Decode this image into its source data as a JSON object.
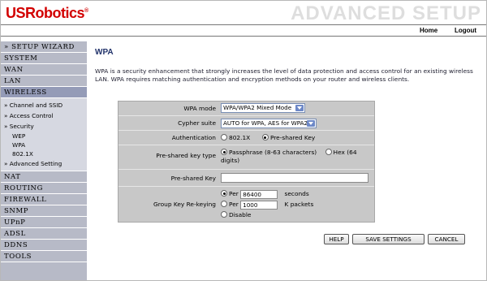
{
  "brand": {
    "logo": "USRobotics",
    "trademark": "®",
    "section_title": "ADVANCED SETUP"
  },
  "topnav": {
    "home": "Home",
    "logout": "Logout"
  },
  "sidebar": {
    "main_top": [
      {
        "label": "» SETUP WIZARD"
      },
      {
        "label": "SYSTEM"
      },
      {
        "label": "WAN"
      },
      {
        "label": "LAN"
      },
      {
        "label": "WIRELESS"
      }
    ],
    "wireless_sub": [
      {
        "label": "» Channel and SSID"
      },
      {
        "label": "» Access Control"
      },
      {
        "label": "» Security"
      }
    ],
    "security_sub": [
      {
        "label": "WEP"
      },
      {
        "label": "WPA"
      },
      {
        "label": "802.1X"
      }
    ],
    "advanced_setting": "» Advanced Setting",
    "main_bottom": [
      {
        "label": "NAT"
      },
      {
        "label": "ROUTING"
      },
      {
        "label": "FIREWALL"
      },
      {
        "label": "SNMP"
      },
      {
        "label": "UPnP"
      },
      {
        "label": "ADSL"
      },
      {
        "label": "DDNS"
      },
      {
        "label": "TOOLS"
      }
    ]
  },
  "page": {
    "title": "WPA",
    "description": "WPA is a security enhancement that strongly increases the level of data protection and access control for an existing wireless LAN. WPA requires matching authentication and encryption methods on your router and wireless clients."
  },
  "form": {
    "wpa_mode": {
      "label": "WPA mode",
      "value": "WPA/WPA2 Mixed Mode"
    },
    "cypher_suite": {
      "label": "Cypher suite",
      "value": "AUTO for WPA, AES for WPA2"
    },
    "authentication": {
      "label": "Authentication",
      "option1": "802.1X",
      "option2": "Pre-shared Key",
      "selected": "Pre-shared Key"
    },
    "psk_type": {
      "label": "Pre-shared key type",
      "option1": "Passphrase (8-63 characters)",
      "option2": "Hex (64 digits)",
      "selected": "Passphrase (8-63 characters)"
    },
    "psk": {
      "label": "Pre-shared Key",
      "value": ""
    },
    "rekey": {
      "label": "Group Key Re-keying",
      "per_label": "Per",
      "seconds_value": "86400",
      "seconds_unit": "seconds",
      "packets_value": "1000",
      "packets_unit": "K packets",
      "disable": "Disable",
      "selected": "seconds"
    }
  },
  "buttons": {
    "help": "HELP",
    "save": "SAVE SETTINGS",
    "cancel": "CANCEL"
  },
  "colors": {
    "brand_red": "#d20000",
    "sidebar": "#b7bac7",
    "sidebar_active": "#949bb7",
    "sidebar_sub": "#d6d8e1",
    "panel": "#c8c8c8",
    "title_blue": "#22336b"
  }
}
